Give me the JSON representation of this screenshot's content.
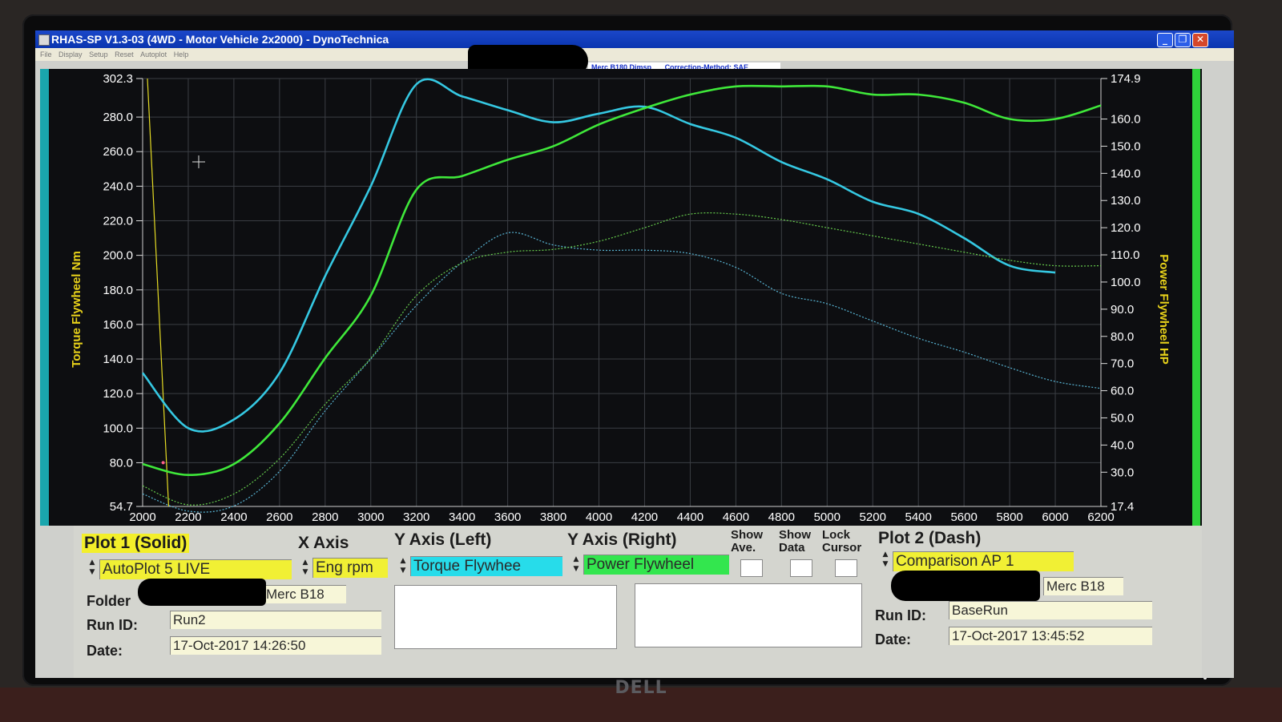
{
  "window": {
    "title": "RHAS-SP V1.3-03  (4WD - Motor Vehicle 2x2000) - DynoTechnica",
    "buttons": {
      "minimize": "_",
      "maximize": "❐",
      "close": "✕"
    }
  },
  "menu": [
    "File",
    "Display",
    "Setup",
    "Reset",
    "Autoplot",
    "Help"
  ],
  "info_strip": {
    "vehicle": "Merc B180 Dimsp",
    "correction": "Correction-Method: SAE"
  },
  "chart_data": {
    "type": "line",
    "x": [
      2000,
      2200,
      2400,
      2600,
      2800,
      3000,
      3200,
      3400,
      3600,
      3800,
      4000,
      4200,
      4400,
      4600,
      4800,
      5000,
      5200,
      5400,
      5600,
      5800,
      6000,
      6200
    ],
    "x_ticks": [
      "2000",
      "2200",
      "2400",
      "2600",
      "2800",
      "3000",
      "3200",
      "3400",
      "3600",
      "3800",
      "4000",
      "4200",
      "4400",
      "4600",
      "4800",
      "5000",
      "5200",
      "5400",
      "5600",
      "5800",
      "6000",
      "6200"
    ],
    "y_left_ticks": [
      "302.3",
      "280.0",
      "260.0",
      "240.0",
      "220.0",
      "200.0",
      "180.0",
      "160.0",
      "140.0",
      "120.0",
      "100.0",
      "80.0",
      "54.7"
    ],
    "y_right_ticks": [
      "174.9",
      "160.0",
      "150.0",
      "140.0",
      "130.0",
      "120.0",
      "110.0",
      "100.0",
      "90.0",
      "80.0",
      "70.0",
      "60.0",
      "50.0",
      "40.0",
      "30.0",
      "17.4"
    ],
    "ylim_left": [
      54.7,
      302.3
    ],
    "ylim_right": [
      17.4,
      174.9
    ],
    "ylabel_left": "Torque Flywheel Nm",
    "ylabel_right": "Power Flywheel HP",
    "grid": true,
    "series": [
      {
        "color": "#35c8e2",
        "axis": "left",
        "style": "solid",
        "values": [
          132,
          100,
          105,
          132,
          188,
          240,
          299,
          292,
          284,
          277,
          282,
          286,
          276,
          268,
          254,
          244,
          231,
          224,
          210,
          194,
          190,
          null
        ]
      },
      {
        "color": "#3fe83a",
        "axis": "right",
        "style": "solid",
        "values": [
          33,
          29,
          33,
          48,
          72,
          95,
          134,
          139,
          145,
          150,
          158,
          164,
          169,
          172,
          172,
          172,
          169,
          169,
          166,
          160,
          160,
          165
        ]
      },
      {
        "color": "#58b5d5",
        "axis": "left",
        "style": "dashed",
        "values": [
          62,
          52,
          55,
          75,
          110,
          140,
          171,
          196,
          213,
          206,
          203,
          203,
          201,
          193,
          178,
          172,
          162,
          152,
          144,
          135,
          127,
          123
        ]
      },
      {
        "color": "#66cc4c",
        "axis": "right",
        "style": "dashed",
        "values": [
          25,
          18,
          22,
          35,
          55,
          72,
          95,
          107,
          111,
          112,
          115,
          120,
          125,
          125,
          123,
          120,
          117,
          114,
          111,
          108,
          106,
          106
        ]
      }
    ]
  },
  "panel": {
    "plot1": {
      "heading": "Plot 1 (Solid)",
      "source": "AutoPlot 5 LIVE",
      "folder_label": "Folder",
      "folder_value": "Merc B18",
      "run_id_label": "Run ID:",
      "run_id": "Run2",
      "date_label": "Date:",
      "date": "17-Oct-2017  14:26:50"
    },
    "x_axis": {
      "heading": "X Axis",
      "value": "Eng rpm"
    },
    "y_left": {
      "heading": "Y Axis (Left)",
      "value": "Torque Flywhee"
    },
    "y_right": {
      "heading": "Y Axis (Right)",
      "value": "Power Flywheel"
    },
    "show_ave": "Show\nAve.",
    "show_data": "Show\nData",
    "lock_cursor": "Lock\nCursor",
    "plot2": {
      "heading": "Plot 2 (Dash)",
      "source": "Comparison AP 1",
      "folder_value": "Merc B18",
      "run_id_label": "Run ID:",
      "run_id": "BaseRun",
      "date_label": "Date:",
      "date": "17-Oct-2017  13:45:52"
    }
  },
  "colors": {
    "torque_solid": "#35c8e2",
    "power_solid": "#3fe83a",
    "axis_label": "#e8d21a",
    "field_yellow": "#f1f034",
    "field_cyan": "#27dcea",
    "field_green": "#33e64e"
  }
}
